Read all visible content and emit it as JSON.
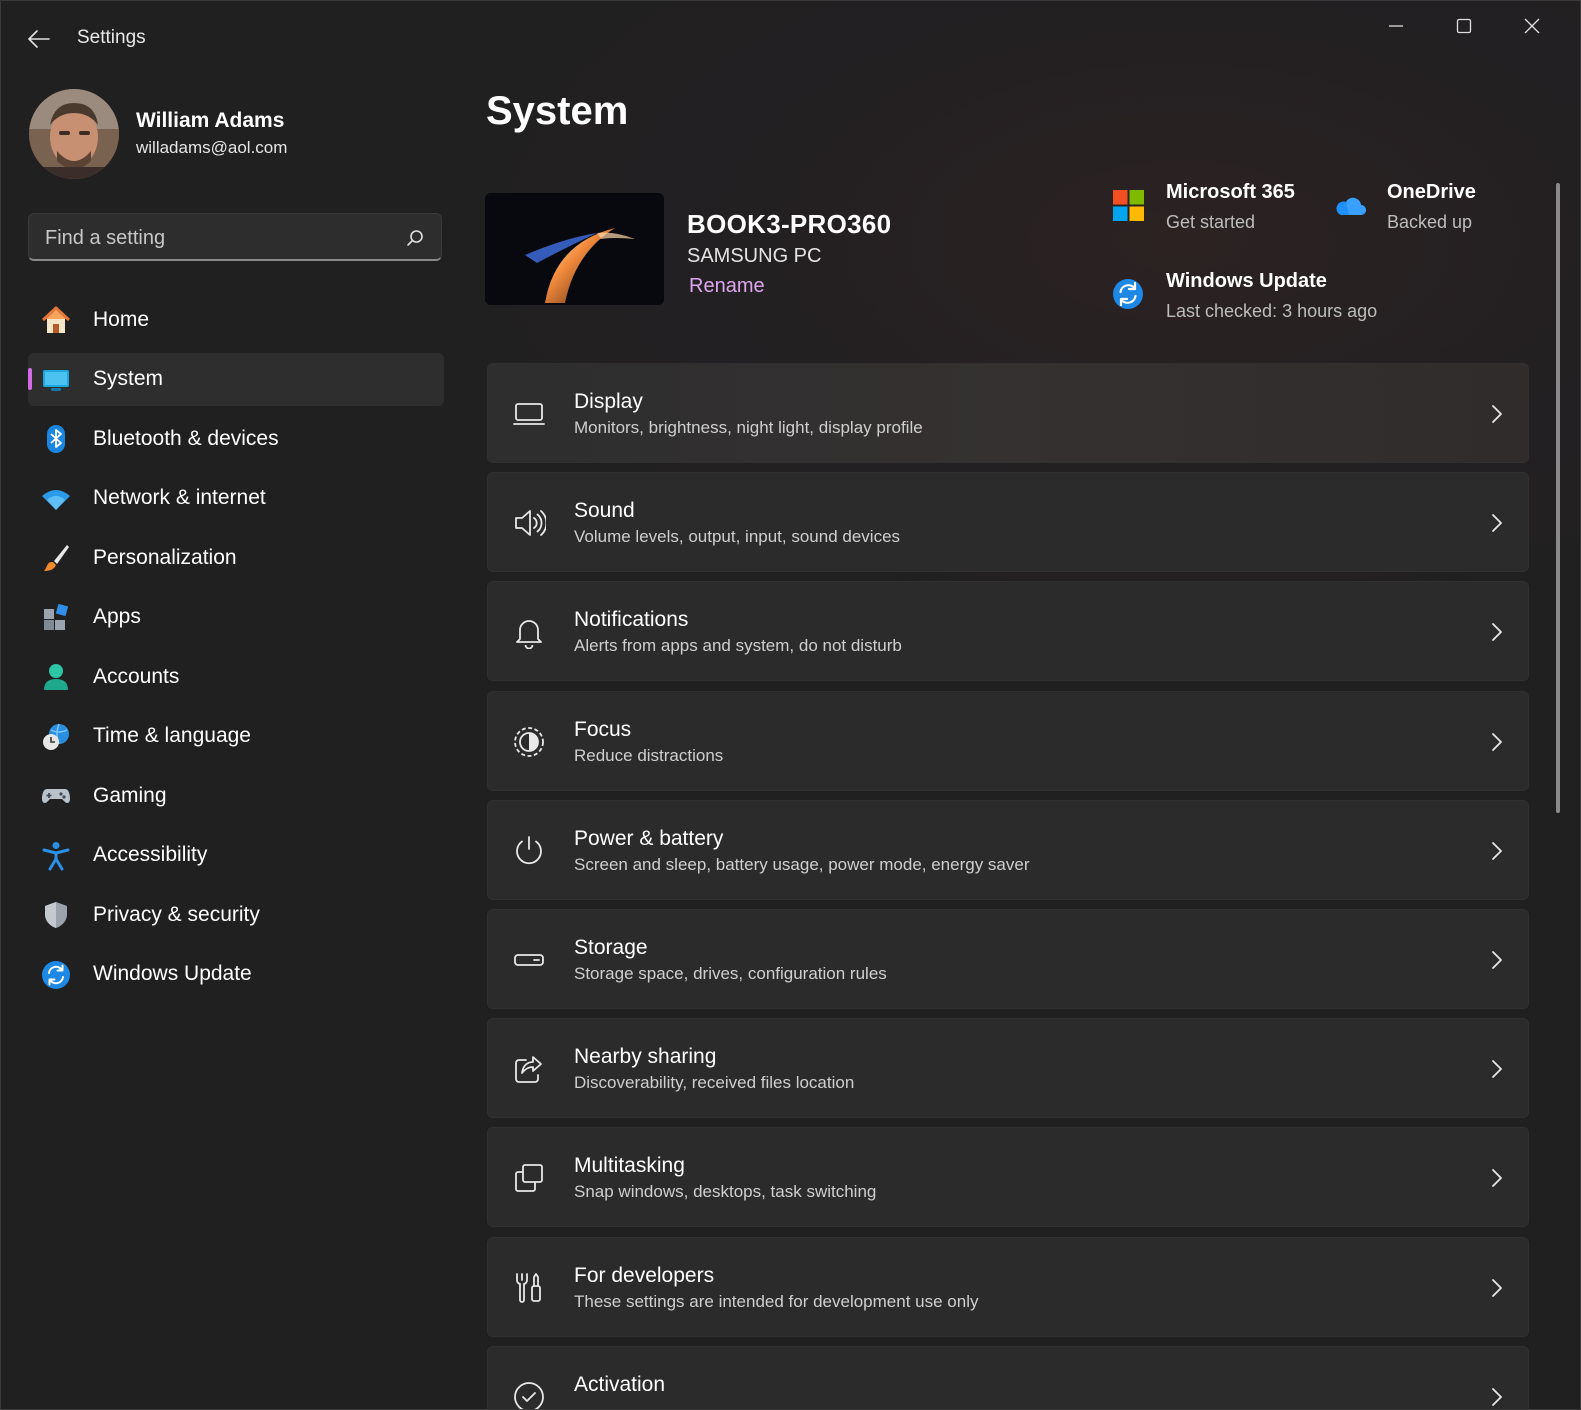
{
  "window": {
    "title": "Settings"
  },
  "profile": {
    "name": "William Adams",
    "email": "willadams@aol.com"
  },
  "search": {
    "placeholder": "Find a setting"
  },
  "nav": {
    "items": [
      {
        "label": "Home",
        "icon": "home-icon"
      },
      {
        "label": "System",
        "icon": "system-icon",
        "active": true
      },
      {
        "label": "Bluetooth & devices",
        "icon": "bluetooth-icon"
      },
      {
        "label": "Network & internet",
        "icon": "wifi-icon"
      },
      {
        "label": "Personalization",
        "icon": "brush-icon"
      },
      {
        "label": "Apps",
        "icon": "apps-icon"
      },
      {
        "label": "Accounts",
        "icon": "accounts-icon"
      },
      {
        "label": "Time & language",
        "icon": "time-language-icon"
      },
      {
        "label": "Gaming",
        "icon": "gamepad-icon"
      },
      {
        "label": "Accessibility",
        "icon": "accessibility-icon"
      },
      {
        "label": "Privacy & security",
        "icon": "shield-icon"
      },
      {
        "label": "Windows Update",
        "icon": "update-icon"
      }
    ]
  },
  "main": {
    "title": "System",
    "device": {
      "name": "BOOK3-PRO360",
      "model": "SAMSUNG PC",
      "rename": "Rename"
    },
    "tiles": {
      "m365": {
        "title": "Microsoft 365",
        "subtitle": "Get started"
      },
      "onedrive": {
        "title": "OneDrive",
        "subtitle": "Backed up"
      },
      "update": {
        "title": "Windows Update",
        "subtitle": "Last checked: 3 hours ago"
      }
    },
    "cards": [
      {
        "title": "Display",
        "subtitle": "Monitors, brightness, night light, display profile",
        "icon": "display-icon"
      },
      {
        "title": "Sound",
        "subtitle": "Volume levels, output, input, sound devices",
        "icon": "speaker-icon"
      },
      {
        "title": "Notifications",
        "subtitle": "Alerts from apps and system, do not disturb",
        "icon": "bell-icon"
      },
      {
        "title": "Focus",
        "subtitle": "Reduce distractions",
        "icon": "focus-icon"
      },
      {
        "title": "Power & battery",
        "subtitle": "Screen and sleep, battery usage, power mode, energy saver",
        "icon": "power-icon"
      },
      {
        "title": "Storage",
        "subtitle": "Storage space, drives, configuration rules",
        "icon": "storage-icon"
      },
      {
        "title": "Nearby sharing",
        "subtitle": "Discoverability, received files location",
        "icon": "share-icon"
      },
      {
        "title": "Multitasking",
        "subtitle": "Snap windows, desktops, task switching",
        "icon": "multitasking-icon"
      },
      {
        "title": "For developers",
        "subtitle": "These settings are intended for development use only",
        "icon": "developer-tools-icon"
      },
      {
        "title": "Activation",
        "subtitle": "",
        "icon": "activation-icon"
      }
    ]
  },
  "colors": {
    "accent": "#d36be4",
    "link": "#dca7ee",
    "background": "#202020",
    "card": "#2b2b2b"
  }
}
